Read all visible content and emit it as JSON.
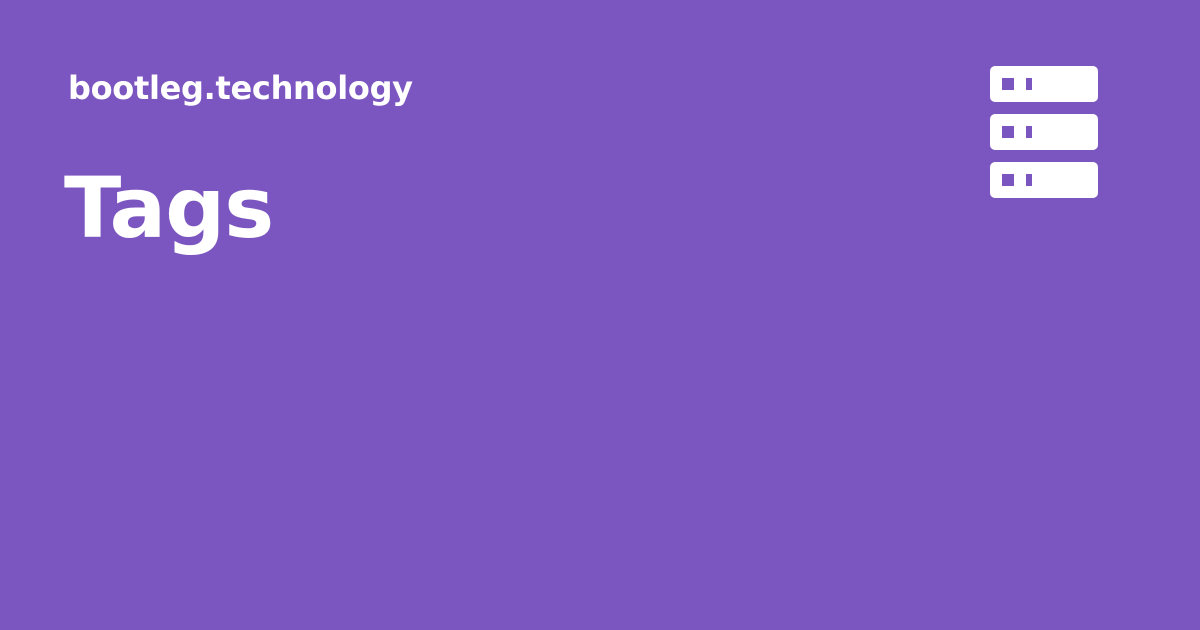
{
  "site": {
    "name": "bootleg.technology"
  },
  "page": {
    "title": "Tags"
  },
  "logo": {
    "icon": "server-stack-icon"
  },
  "colors": {
    "background": "#7c56c0",
    "foreground": "#ffffff"
  }
}
